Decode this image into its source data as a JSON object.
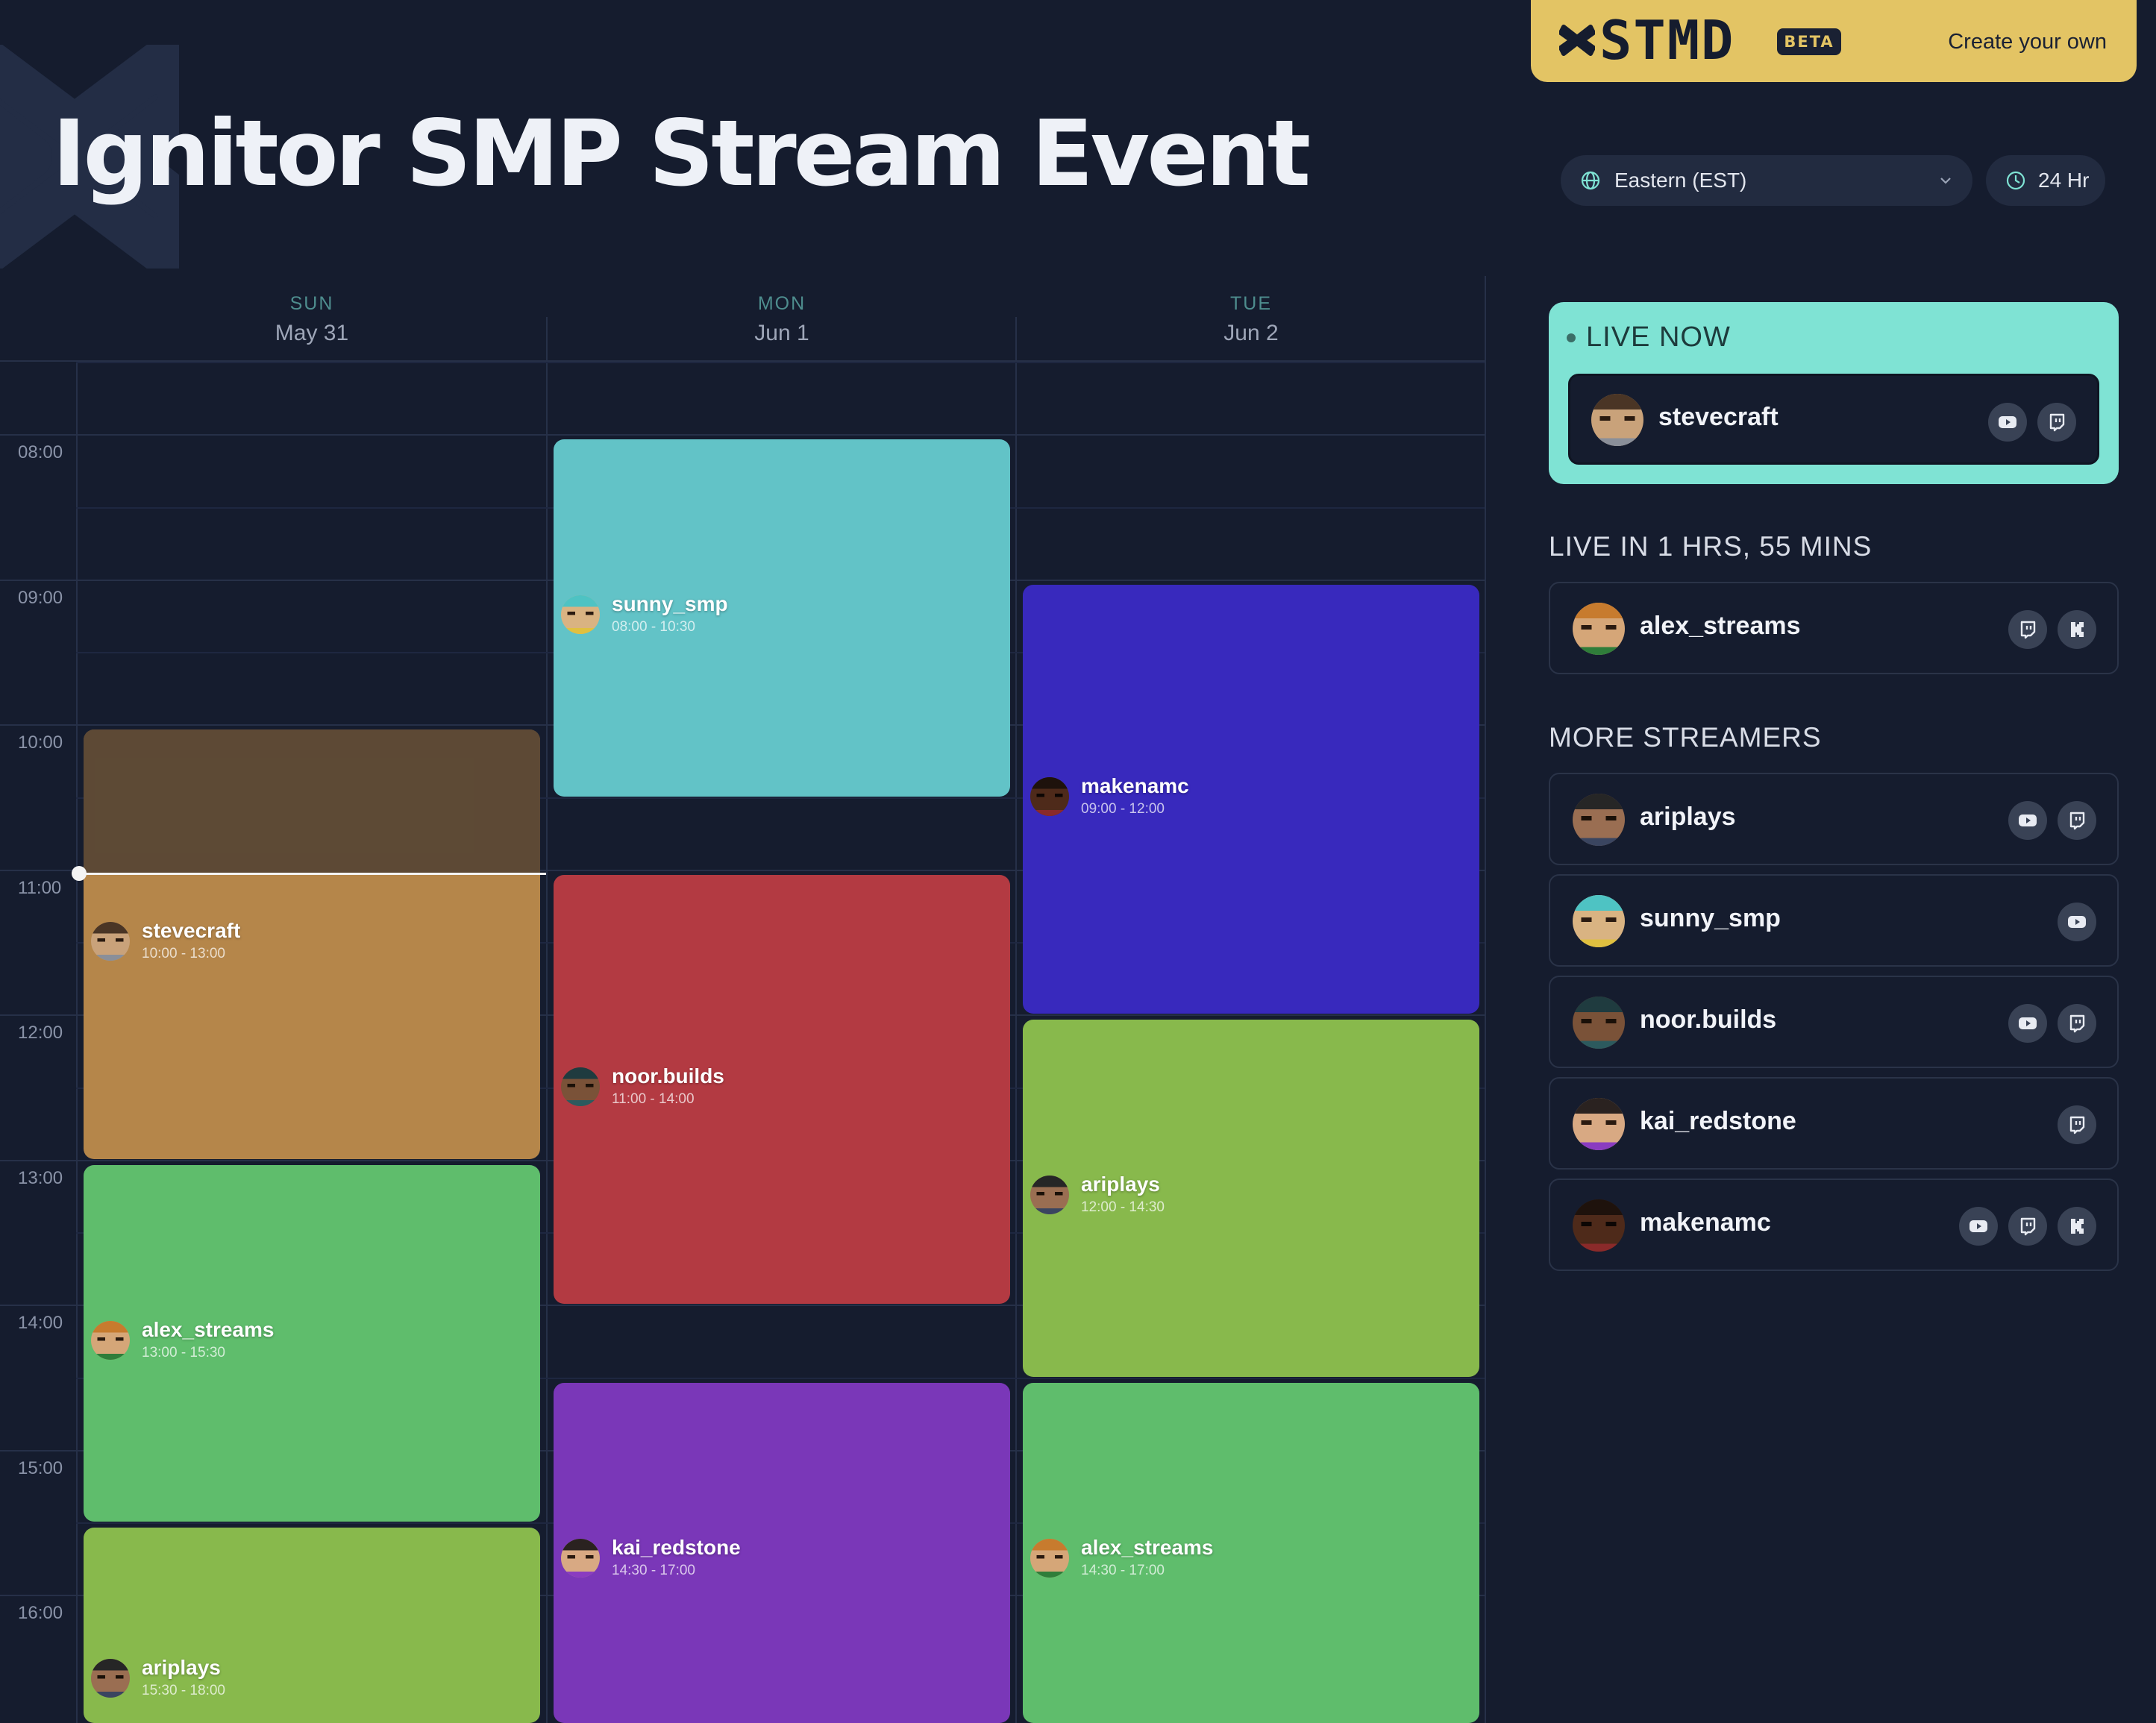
{
  "page": {
    "title": "Ignitor SMP Stream Event"
  },
  "banner": {
    "brand": "STMD",
    "badge": "BETA",
    "cta": "Create your own"
  },
  "controls": {
    "timezone": "Eastern (EST)",
    "hour_format": "24 Hr"
  },
  "calendar": {
    "days": [
      {
        "dow": "SUN",
        "date": "May 31"
      },
      {
        "dow": "MON",
        "date": "Jun 1"
      },
      {
        "dow": "TUE",
        "date": "Jun 2"
      }
    ],
    "times": [
      "08:00",
      "09:00",
      "10:00",
      "11:00",
      "12:00",
      "13:00",
      "14:00",
      "15:00",
      "16:00"
    ],
    "events": [
      {
        "name": "stevecraft",
        "time": "10:00 - 13:00",
        "color": "#b5864a"
      },
      {
        "name": "alex_streams",
        "time": "13:00 - 15:30",
        "color": "#5fbd6c"
      },
      {
        "name": "ariplays",
        "time": "15:30 - 18:00",
        "color": "#88b94c"
      },
      {
        "name": "sunny_smp",
        "time": "08:00 - 10:30",
        "color": "#62c3c7"
      },
      {
        "name": "noor.builds",
        "time": "11:00 - 14:00",
        "color": "#b33a42"
      },
      {
        "name": "kai_redstone",
        "time": "14:30 - 17:00",
        "color": "#7a37b8"
      },
      {
        "name": "makenamc",
        "time": "09:00 - 12:00",
        "color": "#3829bd"
      },
      {
        "name": "ariplays",
        "time": "12:00 - 14:30",
        "color": "#88b94c"
      },
      {
        "name": "alex_streams",
        "time": "14:30 - 17:00",
        "color": "#5fbd6c"
      }
    ]
  },
  "panel": {
    "live_now": {
      "title": "LIVE NOW",
      "streamer": "stevecraft"
    },
    "next": {
      "title": "LIVE IN 1 HRS, 55 MINS",
      "streamer": "alex_streams"
    },
    "more": {
      "title": "MORE STREAMERS",
      "streamers": [
        "ariplays",
        "sunny_smp",
        "noor.builds",
        "kai_redstone",
        "makenamc"
      ]
    }
  }
}
